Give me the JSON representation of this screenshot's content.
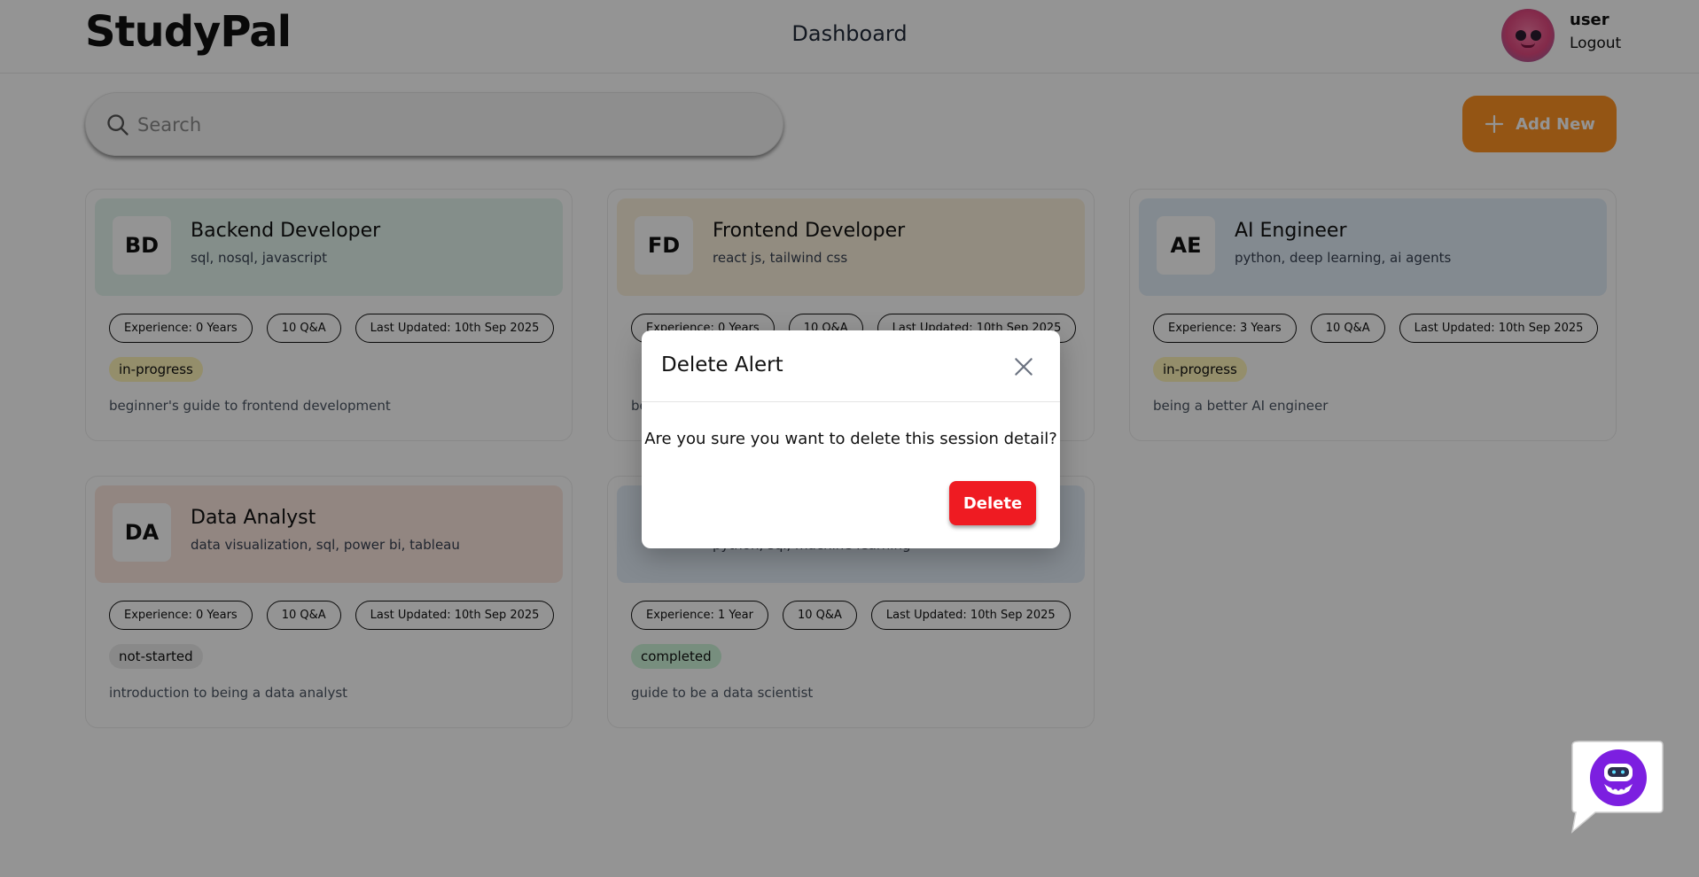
{
  "header": {
    "logo": "StudyPal",
    "nav_title": "Dashboard",
    "user_name": "user",
    "logout": "Logout"
  },
  "search": {
    "placeholder": "Search"
  },
  "add_button": {
    "label": "Add New"
  },
  "cards": [
    {
      "initials": "BD",
      "role": "Backend Developer",
      "topics": "sql, nosql, javascript",
      "experience": "Experience: 0 Years",
      "qa": "10 Q&A",
      "updated": "Last Updated: 10th Sep 2025",
      "status": "in-progress",
      "description": "beginner's guide to frontend development",
      "color": "#e3f4ee"
    },
    {
      "initials": "FD",
      "role": "Frontend Developer",
      "topics": "react js, tailwind css",
      "experience": "Experience: 0 Years",
      "qa": "10 Q&A",
      "updated": "Last Updated: 10th Sep 2025",
      "status": "",
      "description": "be",
      "color": "#fcf1dc"
    },
    {
      "initials": "AE",
      "role": "AI Engineer",
      "topics": "python, deep learning, ai agents",
      "experience": "Experience: 3 Years",
      "qa": "10 Q&A",
      "updated": "Last Updated: 10th Sep 2025",
      "status": "in-progress",
      "description": "being a better AI engineer",
      "color": "#e2eef9"
    },
    {
      "initials": "DA",
      "role": "Data Analyst",
      "topics": "data visualization, sql, power bi, tableau",
      "experience": "Experience: 0 Years",
      "qa": "10 Q&A",
      "updated": "Last Updated: 10th Sep 2025",
      "status": "not-started",
      "description": "introduction to being a data analyst",
      "color": "#fbe7df"
    },
    {
      "initials": "",
      "role": "",
      "topics": "python, sql, machine learning",
      "experience": "Experience: 1 Year",
      "qa": "10 Q&A",
      "updated": "Last Updated: 10th Sep 2025",
      "status": "completed",
      "description": "guide to be a data scientist",
      "color": "#e3eef8"
    }
  ],
  "status_colors": {
    "in-progress": "#fff4b8",
    "not-started": "#ededed",
    "completed": "#cdf5da"
  },
  "modal": {
    "title": "Delete Alert",
    "message": "Are you sure you want to delete this session detail?",
    "delete_label": "Delete"
  },
  "colors": {
    "accent_orange": "#ff9324",
    "danger_red": "#ef1b22",
    "bot_purple": "#7c1fe0"
  }
}
